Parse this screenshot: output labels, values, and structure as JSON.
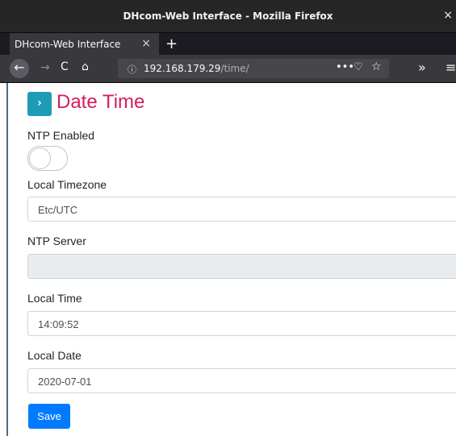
{
  "window": {
    "title": "DHcom-Web Interface - Mozilla Firefox",
    "close_glyph": "×"
  },
  "tabs": [
    {
      "label": "DHcom-Web Interface",
      "close_glyph": "×"
    }
  ],
  "new_tab_glyph": "+",
  "nav": {
    "back_icon": "←",
    "forward_icon": "→",
    "reload_icon": "C",
    "home_icon": "⌂",
    "info_icon": "ⓘ",
    "url_host": "192.168.179.29",
    "url_path": "/time/",
    "more_icon": "•••",
    "pocket_icon": "♡",
    "star_icon": "☆",
    "overflow_icon": "»",
    "menu_icon": "≡"
  },
  "page": {
    "heading_icon": "›",
    "title": "Date Time"
  },
  "form": {
    "ntp_enabled_label": "NTP Enabled",
    "ntp_enabled": false,
    "timezone_label": "Local Timezone",
    "timezone_value": "Etc/UTC",
    "ntp_server_label": "NTP Server",
    "ntp_server_value": "",
    "time_label": "Local Time",
    "time_value": "14:09:52",
    "date_label": "Local Date",
    "date_value": "2020-07-01",
    "save_label": "Save"
  },
  "colors": {
    "accent_title": "#d81b60",
    "heading_icon_bg": "#1e9bb5",
    "button": "#007bff"
  }
}
